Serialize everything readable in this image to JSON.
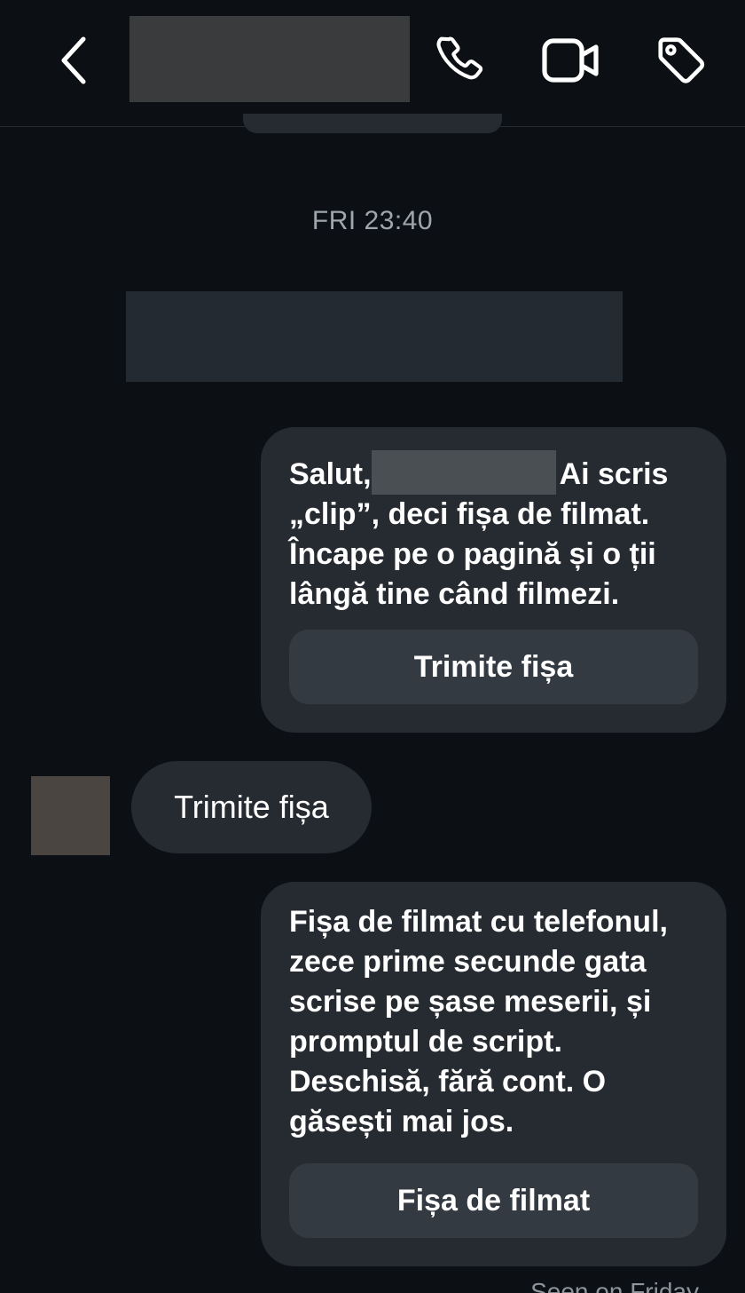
{
  "header": {
    "back_icon": "chevron-left-icon",
    "call_icon": "phone-icon",
    "video_icon": "video-camera-icon",
    "tag_icon": "tag-icon"
  },
  "thread": {
    "timestamp": "FRI 23:40",
    "messages": [
      {
        "direction": "outgoing",
        "text_before_redaction": "Salut,",
        "text_after_redaction": "Ai scris „clip”, deci fișa de filmat. Încape pe o pagină și o ții lângă tine când filmezi.",
        "button_label": "Trimite fișa"
      },
      {
        "direction": "incoming",
        "text": "Trimite fișa"
      },
      {
        "direction": "outgoing",
        "text": "Fișa de filmat cu telefonul, zece prime secunde gata scrise pe șase meserii, și promptul de script. Deschisă, fără cont. O găsești mai jos.",
        "button_label": "Fișa de filmat"
      }
    ],
    "seen_status": "Seen on Friday"
  },
  "colors": {
    "background": "#0c1014",
    "bubble": "#262b31",
    "bubble_button": "#343a42",
    "text": "#ffffff",
    "muted_text": "#a0a6ad"
  }
}
